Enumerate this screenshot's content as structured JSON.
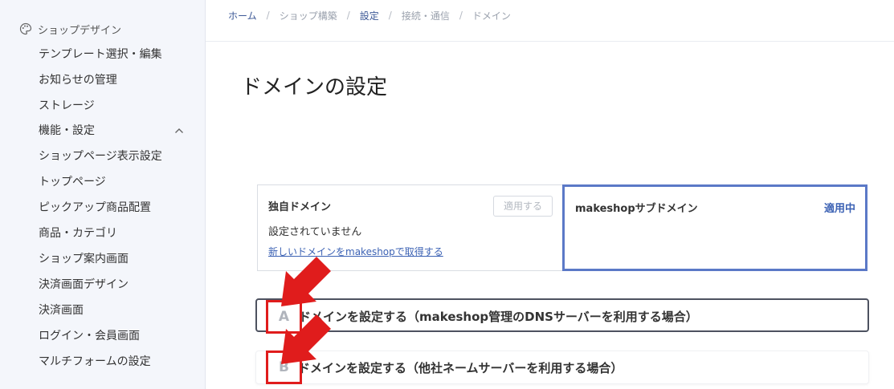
{
  "sidebar": {
    "section_label": "ショップデザイン",
    "items": [
      {
        "label": "テンプレート選択・編集"
      },
      {
        "label": "お知らせの管理"
      },
      {
        "label": "ストレージ"
      },
      {
        "label": "機能・設定"
      },
      {
        "label": "ショップページ表示設定"
      },
      {
        "label": "トップページ"
      },
      {
        "label": "ピックアップ商品配置"
      },
      {
        "label": "商品・カテゴリ"
      },
      {
        "label": "ショップ案内画面"
      },
      {
        "label": "決済画面デザイン"
      },
      {
        "label": "決済画面"
      },
      {
        "label": "ログイン・会員画面"
      },
      {
        "label": "マルチフォームの設定"
      }
    ]
  },
  "breadcrumb": {
    "home": "ホーム",
    "shop_build": "ショップ構築",
    "settings": "設定",
    "connection": "接続・通信",
    "domain": "ドメイン",
    "separator": "/"
  },
  "page": {
    "title": "ドメインの設定"
  },
  "domain_cards": {
    "custom": {
      "title": "独自ドメイン",
      "apply_button": "適用する",
      "status": "設定されていません",
      "link": "新しいドメインをmakeshopで取得する"
    },
    "sub": {
      "title": "makeshopサブドメイン",
      "active_label": "適用中"
    }
  },
  "accordions": [
    {
      "mark": "A",
      "label": "ドメインを設定する（makeshop管理のDNSサーバーを利用する場合）"
    },
    {
      "mark": "B",
      "label": "ドメインを設定する（他社ネームサーバーを利用する場合）"
    }
  ],
  "colors": {
    "accent": "#5b79c7",
    "link": "#3c62b4",
    "annotation_red": "#e01c1c"
  }
}
